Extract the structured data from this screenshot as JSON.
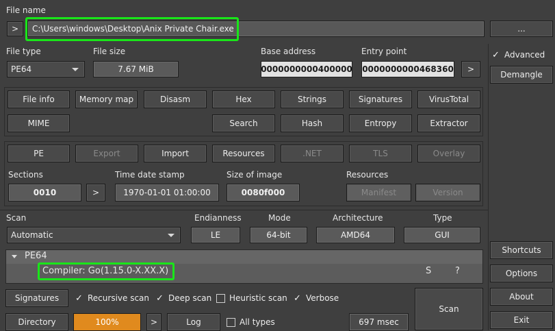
{
  "file": {
    "label": "File name",
    "expand_symbol": ">",
    "path": "C:\\Users\\windows\\Desktop\\Anix Private Chair.exe",
    "browse_label": "..."
  },
  "info": {
    "file_type_label": "File type",
    "file_type_value": "PE64",
    "file_size_label": "File size",
    "file_size_value": "7.67 MiB",
    "base_address_label": "Base address",
    "base_address_value": "0000000000400000",
    "entry_point_label": "Entry point",
    "entry_point_value": "0000000000468360",
    "entry_point_go": ">"
  },
  "right_panel": {
    "advanced_label": "Advanced",
    "advanced_checked": true,
    "demangle_label": "Demangle",
    "shortcuts_label": "Shortcuts",
    "options_label": "Options",
    "about_label": "About",
    "exit_label": "Exit"
  },
  "tools_row1": [
    "File info",
    "Memory map",
    "Disasm",
    "Hex",
    "Strings",
    "Signatures",
    "VirusTotal"
  ],
  "tools_row2": {
    "mime": "MIME",
    "search": "Search",
    "hash": "Hash",
    "entropy": "Entropy",
    "extractor": "Extractor"
  },
  "pe_tabs": {
    "pe": "PE",
    "export": "Export",
    "import": "Import",
    "resources": "Resources",
    "net": ".NET",
    "tls": "TLS",
    "overlay": "Overlay"
  },
  "pe_info": {
    "sections_label": "Sections",
    "sections_value": "0010",
    "sections_go": ">",
    "time_label": "Time date stamp",
    "time_value": "1970-01-01 01:00:00",
    "size_label": "Size of image",
    "size_value": "0080f000",
    "resources_label": "Resources",
    "manifest_label": "Manifest",
    "version_label": "Version"
  },
  "scan_opts": {
    "scan_label": "Scan",
    "scan_value": "Automatic",
    "endianness_label": "Endianness",
    "endianness_value": "LE",
    "mode_label": "Mode",
    "mode_value": "64-bit",
    "arch_label": "Architecture",
    "arch_value": "AMD64",
    "type_label": "Type",
    "type_value": "GUI"
  },
  "results": {
    "header": "PE64",
    "compiler": "Compiler: Go(1.15.0-X.XX.X)",
    "s_label": "S",
    "q_label": "?"
  },
  "bottom": {
    "signatures_label": "Signatures",
    "recursive_label": "Recursive scan",
    "deep_label": "Deep scan",
    "heuristic_label": "Heuristic scan",
    "verbose_label": "Verbose",
    "directory_label": "Directory",
    "progress_text": "100%",
    "progress_value": 100,
    "go_label": ">",
    "log_label": "Log",
    "alltypes_label": "All types",
    "time_text": "697 msec",
    "scan_button": "Scan"
  },
  "colors": {
    "accent_highlight": "#19e619",
    "progress": "#e08a1e",
    "background": "#3f3f3f"
  }
}
